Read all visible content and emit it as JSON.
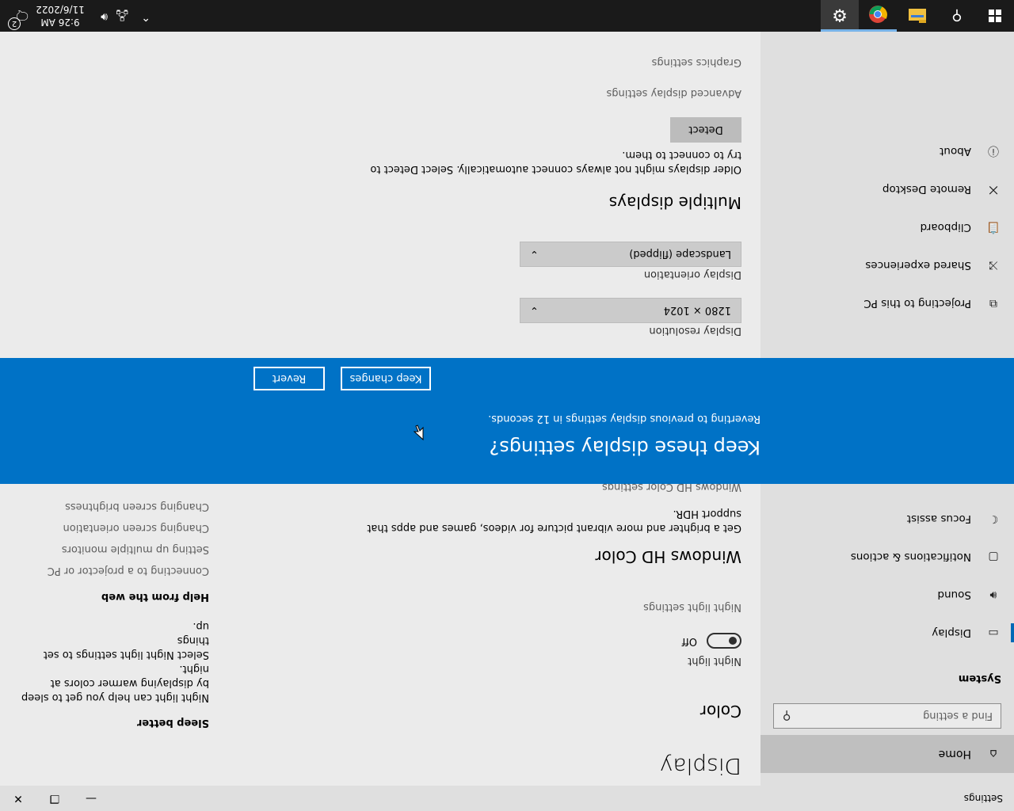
{
  "window": {
    "title": "Settings",
    "minimize_icon": "minimize-icon",
    "maximize_icon": "maximize-icon",
    "close_icon": "close-icon"
  },
  "sidebar": {
    "home_label": "Home",
    "search_placeholder": "Find a setting",
    "section_title": "System",
    "items": [
      {
        "label": "Display",
        "icon": "display-icon",
        "selected": true
      },
      {
        "label": "Sound",
        "icon": "sound-icon"
      },
      {
        "label": "Notifications & actions",
        "icon": "notifications-icon"
      },
      {
        "label": "Focus assist",
        "icon": "moon-icon"
      },
      {
        "label": "Projecting to this PC",
        "icon": "projecting-icon"
      },
      {
        "label": "Shared experiences",
        "icon": "shared-icon"
      },
      {
        "label": "Clipboard",
        "icon": "clipboard-icon"
      },
      {
        "label": "Remote Desktop",
        "icon": "remote-desktop-icon"
      },
      {
        "label": "About",
        "icon": "info-icon"
      }
    ]
  },
  "main": {
    "title": "Display",
    "color_section": "Color",
    "night_light_label": "Night light",
    "night_light_state": "Off",
    "night_light_on": false,
    "night_light_settings_link": "Night light settings",
    "hdr_section": "Windows HD Color",
    "hdr_desc_1": "Get a brighter and more vibrant picture for videos, games and apps that",
    "hdr_desc_2": "support HDR.",
    "hdr_settings_link": "Windows HD Color settings",
    "resolution_label": "Display resolution",
    "resolution_value": "1280 × 1024",
    "orientation_label": "Display orientation",
    "orientation_value": "Landscape (flipped)",
    "multiple_section": "Multiple displays",
    "multiple_desc_1": "Older displays might not always connect automatically. Select Detect to",
    "multiple_desc_2": "try to connect to them.",
    "detect_button": "Detect",
    "advanced_link": "Advanced display settings",
    "graphics_link": "Graphics settings"
  },
  "right": {
    "sleep_title": "Sleep better",
    "sleep_desc_1": "Night light can help you get to sleep",
    "sleep_desc_2": "by displaying warmer colors at night.",
    "sleep_desc_3": "Select Night light settings to set things",
    "sleep_desc_4": "up.",
    "help_title": "Help from the web",
    "help_links": [
      "Connecting to a projector or PC",
      "Setting up multiple monitors",
      "Changing screen orientation",
      "Changing screen brightness"
    ]
  },
  "dialog": {
    "title": "Keep these display settings?",
    "message": "Reverting to previous display settings in 12 seconds.",
    "keep_button": "Keep changes",
    "revert_button": "Revert",
    "background": "#0072c6"
  },
  "taskbar": {
    "time": "9:26 AM",
    "date": "11/6/2022",
    "notification_count": "2",
    "icons": [
      "start-icon",
      "search-icon",
      "file-explorer-icon",
      "chrome-icon",
      "settings-gear-icon"
    ]
  }
}
